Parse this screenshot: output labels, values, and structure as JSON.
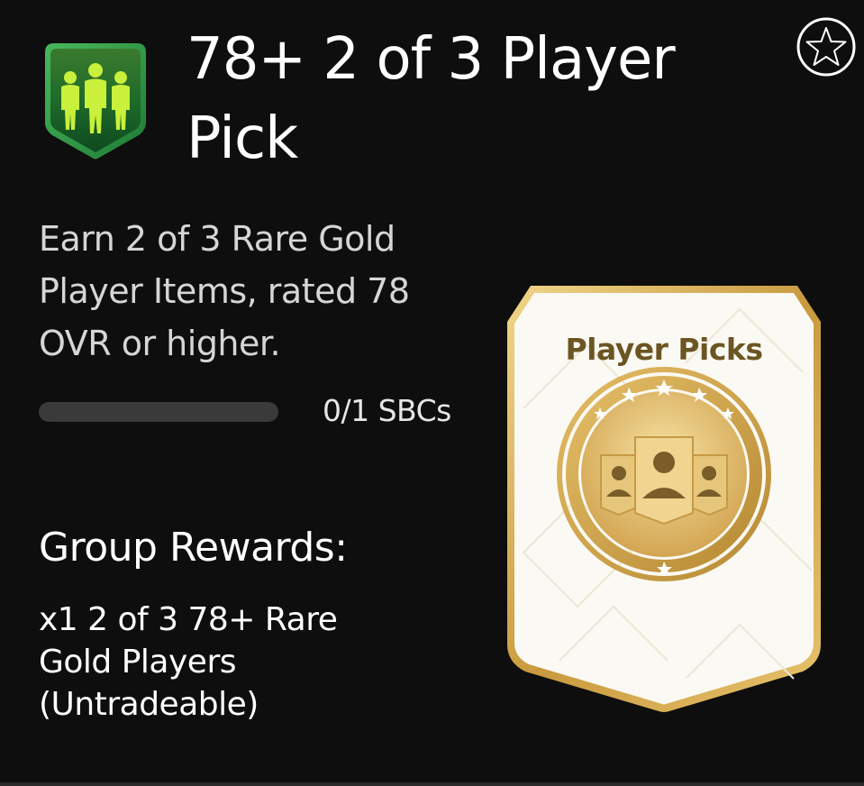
{
  "sbc": {
    "title": "78+ 2 of 3 Player Pick",
    "description": "Earn 2 of 3 Rare Gold Player Items, rated 78 OVR or higher.",
    "progress": {
      "completed": 0,
      "total": 1,
      "label": "0/1 SBCs"
    }
  },
  "rewards": {
    "heading": "Group Rewards:",
    "item_text": "x1 2 of 3 78+ Rare Gold Players (Untradeable)",
    "pack_title": "Player Picks"
  },
  "icons": {
    "badge": "sbc-group-badge-icon",
    "favorite": "star-outline-icon",
    "pack": "player-picks-pack-icon"
  },
  "colors": {
    "background": "#0e0e0e",
    "badge_green": "#2f8a3c",
    "card_gold": "#d4b161",
    "pack_title": "#6b5522"
  }
}
